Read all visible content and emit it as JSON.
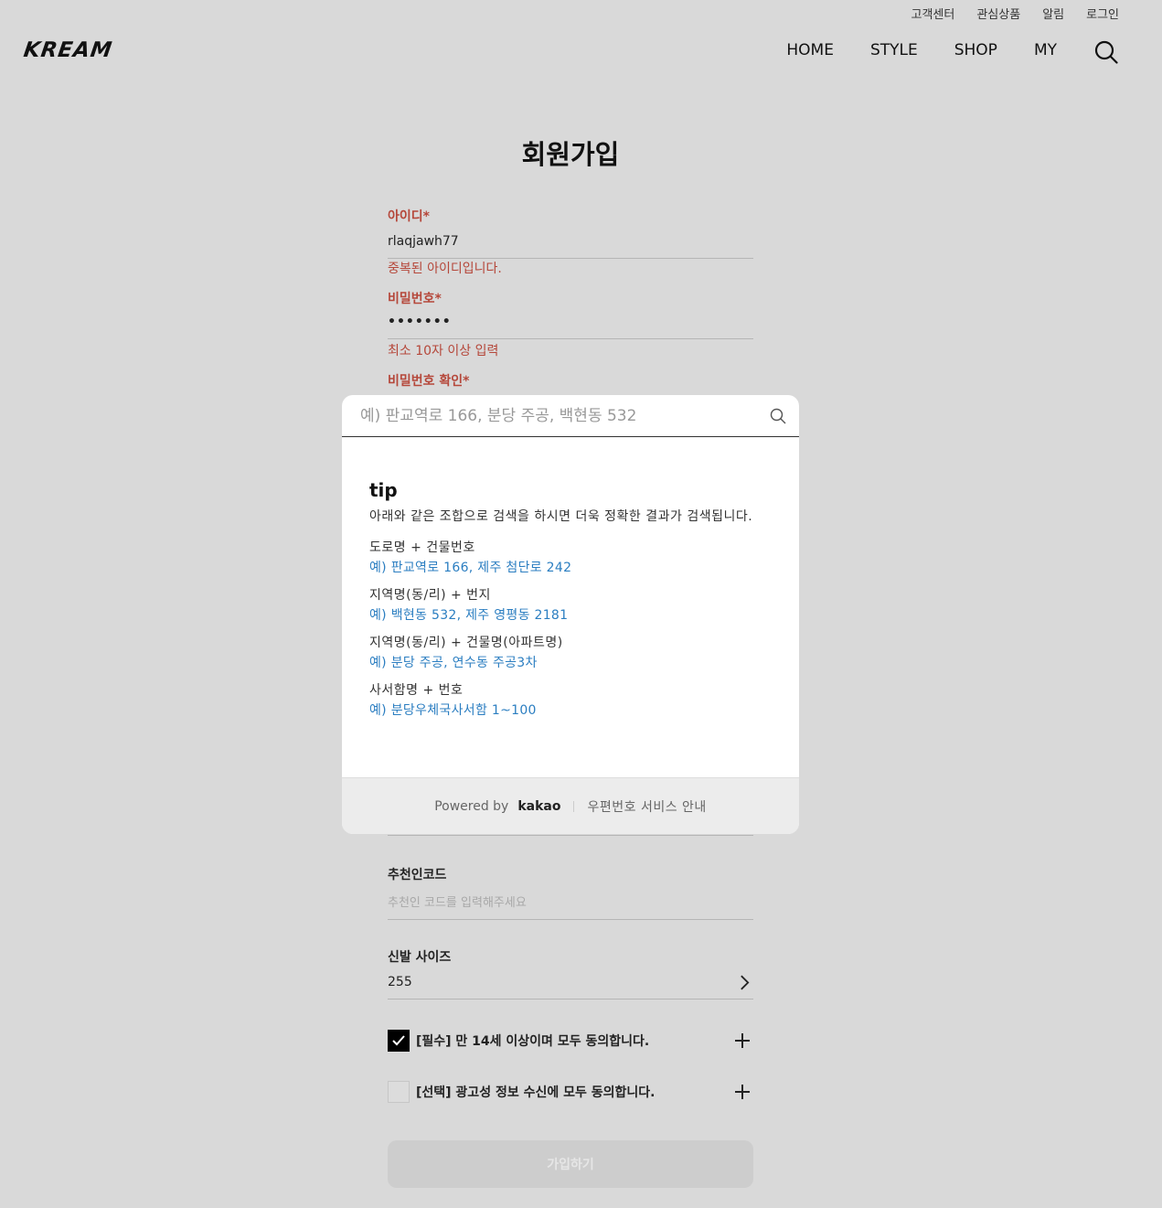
{
  "header": {
    "logo": "KREAM",
    "top_links": [
      "고객센터",
      "관심상품",
      "알림",
      "로그인"
    ],
    "nav": [
      "HOME",
      "STYLE",
      "SHOP",
      "MY"
    ],
    "search_icon": "search-icon"
  },
  "page_title": "회원가입",
  "form": {
    "id_label": "아이디*",
    "id_value": "rlaqjawh77",
    "id_error": "중복된 아이디입니다.",
    "pw_label": "비밀번호*",
    "pw_value": "•••••••",
    "pw_error": "최소 10자 이상 입력",
    "pw_confirm_label": "비밀번호 확인*",
    "referral_label": "추천인코드",
    "referral_placeholder": "추천인 코드를 입력해주세요",
    "shoe_label": "신발 사이즈",
    "shoe_value": "255",
    "agree_required": "[필수] 만 14세 이상이며 모두 동의합니다.",
    "agree_required_checked": true,
    "agree_optional": "[선택] 광고성 정보 수신에 모두 동의합니다.",
    "agree_optional_checked": false,
    "submit_label": "가입하기"
  },
  "postcode_popup": {
    "search_placeholder": "예) 판교역로 166, 분당 주공, 백현동 532",
    "tip_title": "tip",
    "tip_desc": "아래와 같은 조합으로 검색을 하시면 더욱 정확한 결과가 검색됩니다.",
    "tips": [
      {
        "heading": "도로명 + 건물번호",
        "example": "예) 판교역로 166,  제주 첨단로 242"
      },
      {
        "heading": "지역명(동/리) + 번지",
        "example": "예) 백현동 532,  제주 영평동 2181"
      },
      {
        "heading": "지역명(동/리) + 건물명(아파트명)",
        "example": "예) 분당 주공,  연수동 주공3차"
      },
      {
        "heading": "사서함명 + 번호",
        "example": "예) 분당우체국사서함 1~100"
      }
    ],
    "powered_by": "Powered by",
    "brand": "kakao",
    "service_link": "우편번호 서비스 안내"
  }
}
